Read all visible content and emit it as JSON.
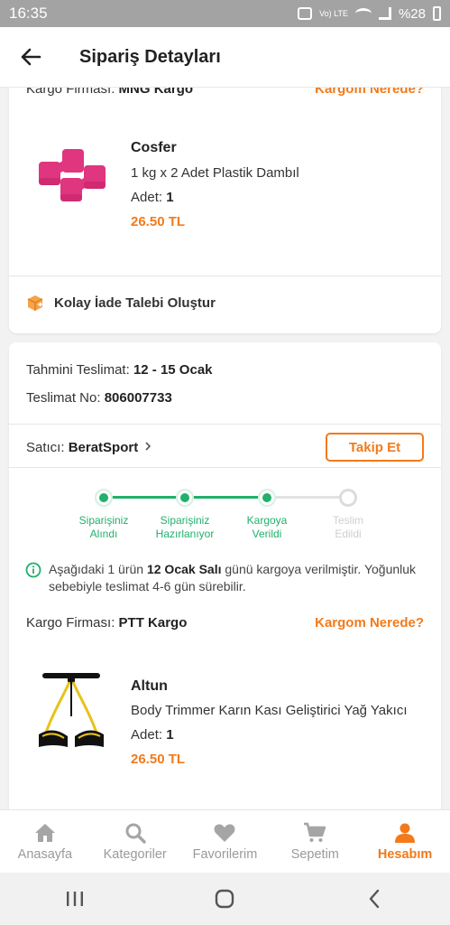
{
  "status_bar": {
    "time": "16:35",
    "battery": "%28",
    "volte": "Vo) LTE"
  },
  "header": {
    "title": "Sipariş Detayları"
  },
  "card1": {
    "cargo_label": "Kargo Firması:",
    "cargo_value": "MNG Kargo",
    "cargo_link": "Kargom Nerede?",
    "product": {
      "brand": "Cosfer",
      "name": "1 kg x 2 Adet Plastik Dambıl",
      "qty_label": "Adet:",
      "qty": "1",
      "price": "26.50 TL"
    },
    "return_label": "Kolay İade Talebi Oluştur"
  },
  "card2": {
    "delivery_label": "Tahmini Teslimat:",
    "delivery_value": "12 - 15 Ocak",
    "delivery_no_label": "Teslimat No:",
    "delivery_no_value": "806007733",
    "seller_label": "Satıcı:",
    "seller_value": "BeratSport",
    "follow_button": "Takip Et",
    "steps": [
      {
        "line1": "Siparişiniz",
        "line2": "Alındı",
        "done": true
      },
      {
        "line1": "Siparişiniz",
        "line2": "Hazırlanıyor",
        "done": true
      },
      {
        "line1": "Kargoya",
        "line2": "Verildi",
        "done": true
      },
      {
        "line1": "Teslim",
        "line2": "Edildi",
        "done": false
      }
    ],
    "info_pre": "Aşağıdaki 1 ürün",
    "info_bold": "12 Ocak Salı",
    "info_post": "günü kargoya verilmiştir. Yoğunluk sebebiyle teslimat 4-6 gün sürebilir.",
    "cargo_label": "Kargo Firması:",
    "cargo_value": "PTT Kargo",
    "cargo_link": "Kargom Nerede?",
    "product": {
      "brand": "Altun",
      "name": "Body Trimmer Karın Kası Geliştirici Yağ Yakıcı",
      "qty_label": "Adet:",
      "qty": "1",
      "price": "26.50 TL"
    }
  },
  "bottom_nav": [
    {
      "label": "Anasayfa",
      "icon": "home-icon",
      "active": false
    },
    {
      "label": "Kategoriler",
      "icon": "search-icon",
      "active": false
    },
    {
      "label": "Favorilerim",
      "icon": "heart-icon",
      "active": false
    },
    {
      "label": "Sepetim",
      "icon": "cart-icon",
      "active": false
    },
    {
      "label": "Hesabım",
      "icon": "user-icon",
      "active": true
    }
  ],
  "colors": {
    "accent": "#f27a1a",
    "success": "#22b06a"
  }
}
